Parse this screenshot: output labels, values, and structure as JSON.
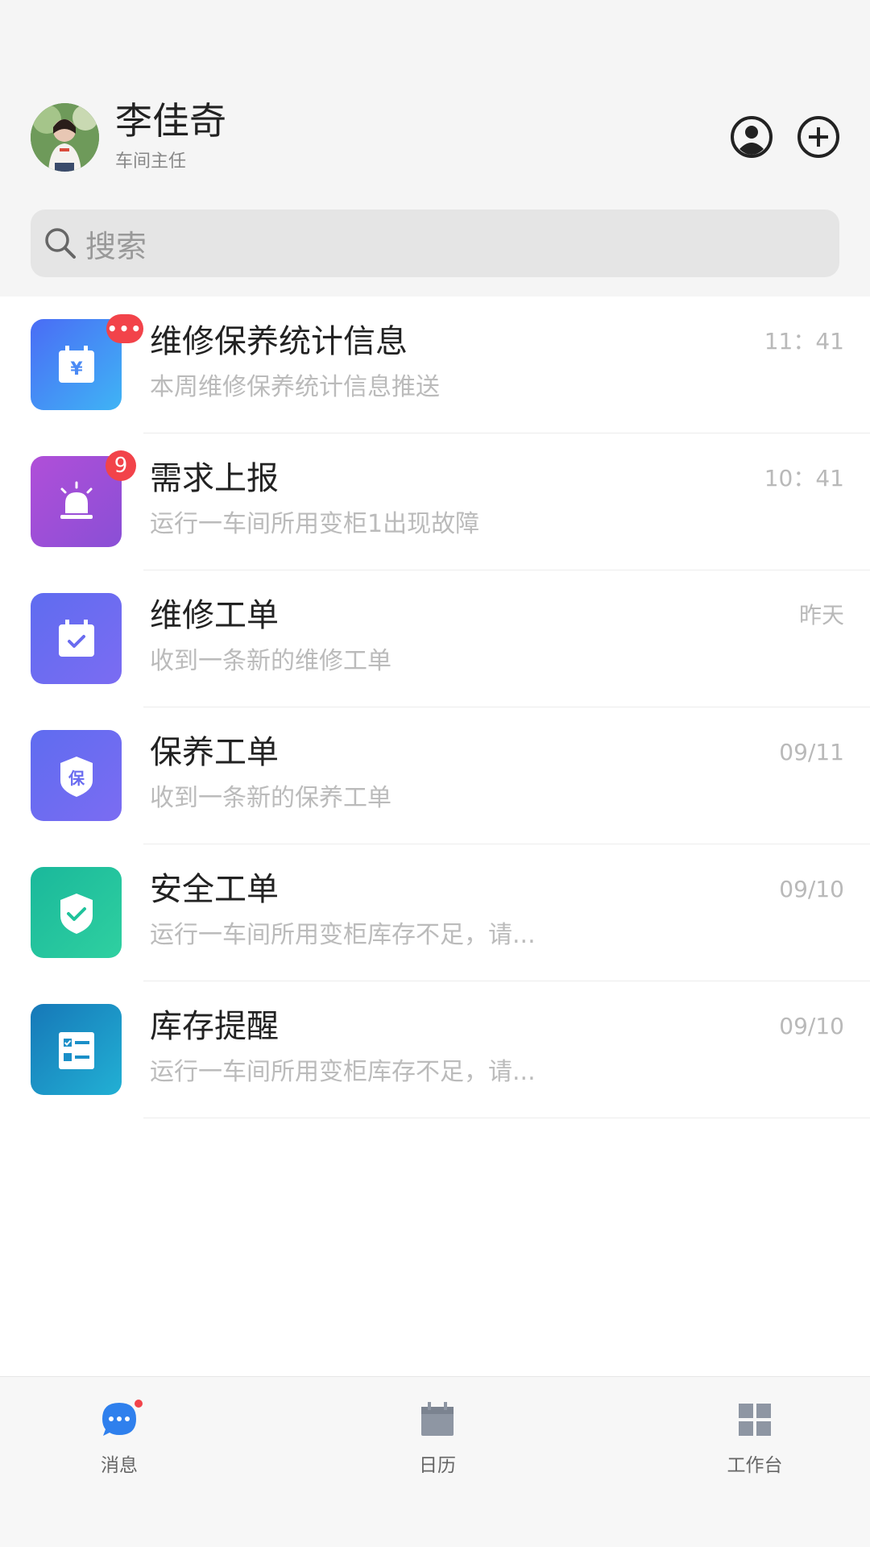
{
  "user": {
    "name": "李佳奇",
    "role": "车间主任"
  },
  "search": {
    "placeholder": "搜索"
  },
  "messages": [
    {
      "title": "维修保养统计信息",
      "subtitle": "本周维修保养统计信息推送",
      "time": "11：41",
      "badge": "•••",
      "icon": "calendar-yen-icon",
      "color": "#3f7ff2"
    },
    {
      "title": "需求上报",
      "subtitle": "运行一车间所用变柜1出现故障",
      "time": "10：41",
      "badge": "9",
      "icon": "alarm-siren-icon",
      "color": "#9a4fd6"
    },
    {
      "title": "维修工单",
      "subtitle": "收到一条新的维修工单",
      "time": "昨天",
      "badge": "",
      "icon": "calendar-check-icon",
      "color": "#6a6cf0"
    },
    {
      "title": "保养工单",
      "subtitle": "收到一条新的保养工单",
      "time": "09/11",
      "badge": "",
      "icon": "shield-bao-icon",
      "color": "#6a6cf0"
    },
    {
      "title": "安全工单",
      "subtitle": "运行一车间所用变柜库存不足，请...",
      "time": "09/10",
      "badge": "",
      "icon": "shield-check-icon",
      "color": "#1fc39b"
    },
    {
      "title": "库存提醒",
      "subtitle": "运行一车间所用变柜库存不足，请...",
      "time": "09/10",
      "badge": "",
      "icon": "checklist-icon",
      "color": "#1a8fc8"
    }
  ],
  "tabs": [
    {
      "label": "消息",
      "icon": "chat-bubble-icon",
      "color": "#2f80ed"
    },
    {
      "label": "日历",
      "icon": "calendar-icon",
      "color": "#8e96a3"
    },
    {
      "label": "工作台",
      "icon": "grid-icon",
      "color": "#8e96a3"
    }
  ]
}
